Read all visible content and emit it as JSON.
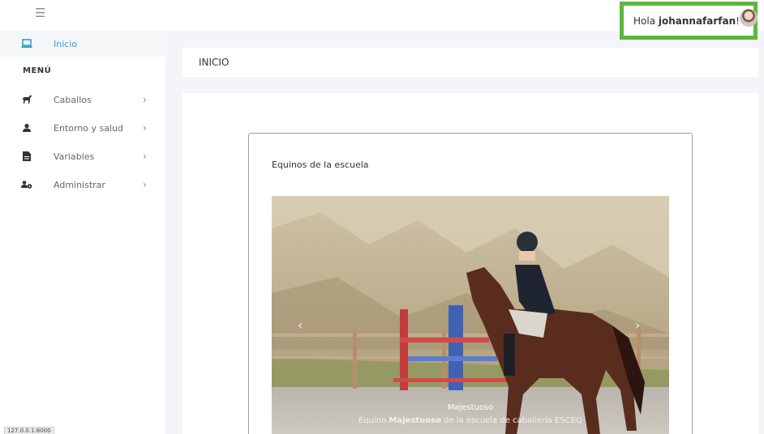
{
  "topbar": {
    "menu_icon": "hamburger-icon",
    "greeting_prefix": "Hola ",
    "username": "johannafarfan",
    "greeting_suffix": "!",
    "highlight_color": "#5cb83a"
  },
  "sidebar": {
    "home": {
      "label": "Inicio",
      "icon": "laptop-icon"
    },
    "menu_heading": "MENÚ",
    "items": [
      {
        "label": "Caballos",
        "icon": "horse-icon"
      },
      {
        "label": "Entorno y salud",
        "icon": "user-icon"
      },
      {
        "label": "Variables",
        "icon": "document-icon"
      },
      {
        "label": "Administrar",
        "icon": "users-cog-icon"
      }
    ],
    "active_color": "#2f9fd1"
  },
  "statusbar": {
    "url": "127.0.0.1:8000"
  },
  "main": {
    "page_title": "INICIO",
    "card": {
      "title": "Equinos de la escuela",
      "slide": {
        "title": "Majestuoso",
        "caption_prefix": "Equino ",
        "caption_bold": "Majestuoso",
        "caption_suffix": " de la escuela de caballería ESCEQ"
      }
    }
  }
}
